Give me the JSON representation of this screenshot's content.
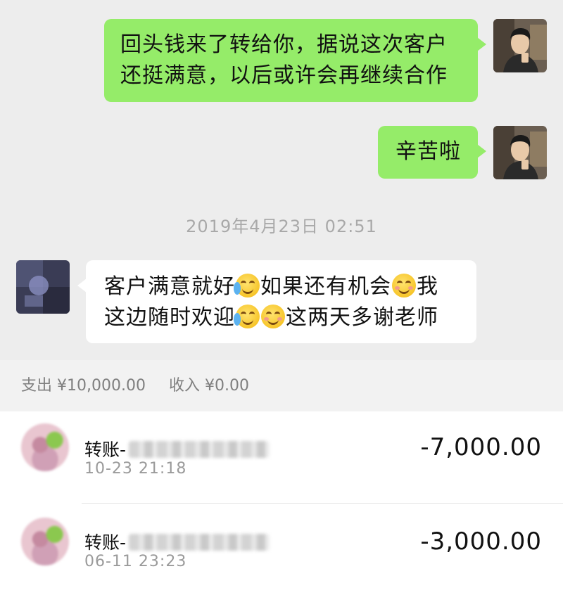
{
  "chat": {
    "messages": [
      {
        "side": "out",
        "lines": [
          "回头钱来了转给你，据说这次客户",
          "还挺满意，以后或许会再继续合作"
        ]
      },
      {
        "side": "out",
        "lines": [
          "辛苦啦"
        ]
      },
      {
        "side": "in",
        "line1_a": "客户满意就好",
        "line1_b": "如果还有机会",
        "line1_c": "我",
        "line2_a": "这边随时欢迎",
        "line2_b": "这两天多谢老师",
        "emojis": [
          "crying-laughing-emoji",
          "smiling-blush-emoji",
          "crying-laughing-emoji",
          "smiling-blush-emoji"
        ]
      }
    ],
    "timestamp": "2019年4月23日 02:51"
  },
  "summary": {
    "expense_label": "支出 ¥10,000.00",
    "income_label": "收入 ¥0.00"
  },
  "transactions": [
    {
      "title": "转账-",
      "time": "10-23  21:18",
      "amount": "-7,000.00"
    },
    {
      "title": "转账-",
      "time": "06-11  23:23",
      "amount": "-3,000.00"
    }
  ],
  "colors": {
    "chat_bg": "#ededed",
    "outgoing_bubble": "#95ec69",
    "incoming_bubble": "#ffffff",
    "summary_bg": "#f2f2f2"
  }
}
